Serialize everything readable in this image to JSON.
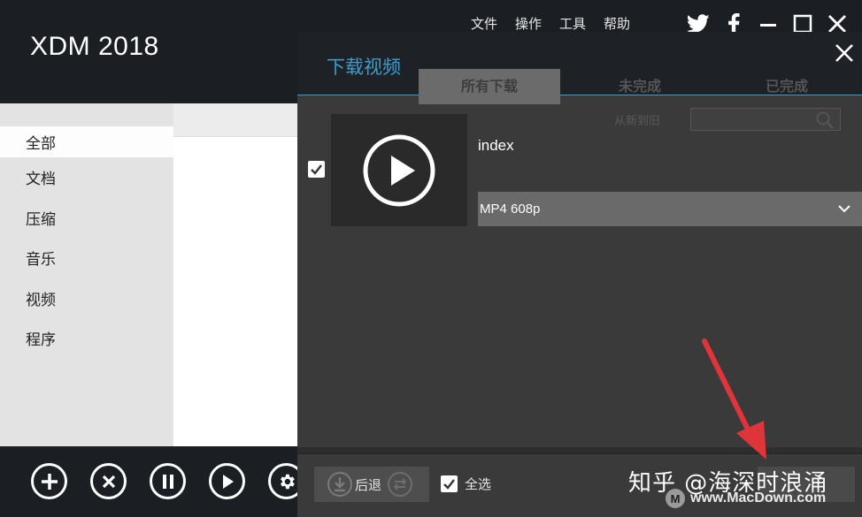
{
  "app": {
    "title": "XDM 2018"
  },
  "menu": [
    {
      "label": "文件"
    },
    {
      "label": "操作"
    },
    {
      "label": "工具"
    },
    {
      "label": "帮助"
    }
  ],
  "window_icons": [
    "twitter-icon",
    "facebook-icon",
    "minimize-icon",
    "maximize-icon",
    "close-icon"
  ],
  "sidebar": {
    "items": [
      {
        "label": "全部",
        "active": true
      },
      {
        "label": "文档"
      },
      {
        "label": "压缩"
      },
      {
        "label": "音乐"
      },
      {
        "label": "视频"
      },
      {
        "label": "程序"
      }
    ]
  },
  "toolbar_icons": [
    "add-icon",
    "delete-icon",
    "pause-icon",
    "resume-icon",
    "settings-icon"
  ],
  "background_tabs": [
    {
      "label": "所有下载",
      "active": true
    },
    {
      "label": "未完成"
    },
    {
      "label": "已完成"
    }
  ],
  "background_sort": {
    "label": "从新到旧"
  },
  "dialog": {
    "title": "下载视频",
    "item": {
      "title": "index",
      "checked": true,
      "format": "MP4 608p"
    },
    "download_button": "后退",
    "select_all": {
      "label": "全选",
      "checked": true
    }
  },
  "watermark": {
    "text": "知乎 @海深时浪涌",
    "site": "www.MacDown.com",
    "logo": "M"
  },
  "colors": {
    "accent": "#3c9dce",
    "annotation_arrow": "#e0343b"
  }
}
